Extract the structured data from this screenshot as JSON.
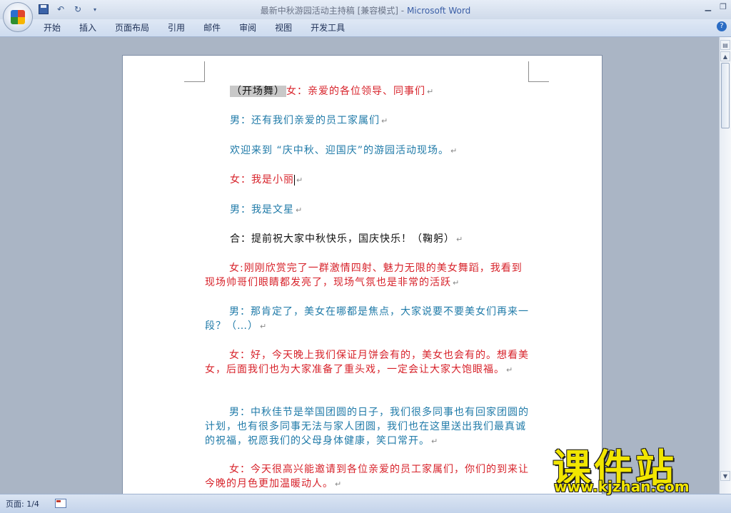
{
  "window": {
    "title_doc": "最新中秋游园活动主持稿 [兼容模式]",
    "title_sep": " - ",
    "title_app": "Microsoft Word"
  },
  "ribbon": {
    "tabs": [
      "开始",
      "插入",
      "页面布局",
      "引用",
      "邮件",
      "审阅",
      "视图",
      "开发工具"
    ]
  },
  "document": {
    "p1_highlight": "（开场舞）",
    "p1_text": "女：亲爱的各位领导、同事们",
    "p2_text": "男：还有我们亲爱的员工家属们",
    "p3_text": "欢迎来到 “庆中秋、迎国庆”的游园活动现场。",
    "p4_text": "女：我是小丽",
    "p5_text": "男：我是文星",
    "p6_text": "合：提前祝大家中秋快乐，国庆快乐！（鞠躬）",
    "p7_text": "女:刚刚欣赏完了一群激情四射、魅力无限的美女舞蹈，我看到现场帅哥们眼睛都发亮了，现场气氛也是非常的活跃",
    "p8_text": "男：那肯定了，美女在哪都是焦点，大家说要不要美女们再来一段？（…）",
    "p9_text": "女：好，今天晚上我们保证月饼会有的，美女也会有的。想看美女，后面我们也为大家准备了重头戏，一定会让大家大饱眼福。",
    "p10_text": "男：中秋佳节是举国团圆的日子，我们很多同事也有回家团圆的计划，也有很多同事无法与家人团圆，我们也在这里送出我们最真诚的祝福，祝愿我们的父母身体健康，笑口常开。",
    "p11_text": "女：今天很高兴能邀请到各位亲爱的员工家属们，你们的到来让今晚的月色更加温暖动人。",
    "para_mark": "↵"
  },
  "statusbar": {
    "page_info": "页面: 1/4"
  },
  "watermark": {
    "chinese": "课件站",
    "url": "www.kjzhan.com"
  },
  "colors": {
    "female_text": "#d7222a",
    "male_text": "#1f7aa8",
    "ribbon_bg": "#cddbef"
  },
  "icons": [
    "office-button-icon",
    "save-icon",
    "undo-icon",
    "redo-icon",
    "customize-qat-icon",
    "minimize-icon",
    "maximize-icon",
    "help-icon",
    "ruler-toggle-icon",
    "scroll-up-icon",
    "scroll-down-icon",
    "macro-record-icon"
  ]
}
